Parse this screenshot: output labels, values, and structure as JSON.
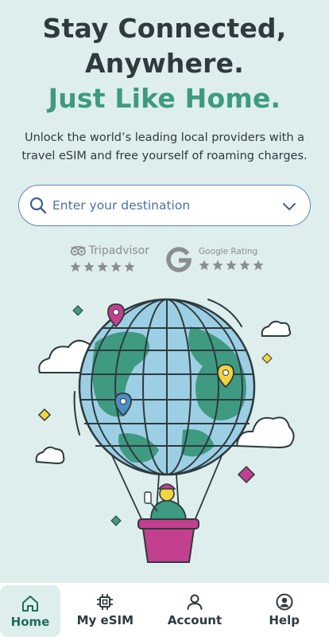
{
  "hero": {
    "line1": "Stay Connected,",
    "line2": "Anywhere.",
    "line3": "Just Like Home."
  },
  "subtitle": "Unlock the world’s leading local providers with a travel eSIM and free yourself of roaming charges.",
  "search": {
    "placeholder": "Enter your destination",
    "icon": "search-icon",
    "dropdown_icon": "chevron-down-icon"
  },
  "ratings": {
    "tripadvisor_label": "Tripadvisor",
    "tripadvisor_stars": 5,
    "google_label": "Google Rating",
    "google_stars": 5
  },
  "nav": {
    "items": [
      {
        "label": "Home",
        "icon": "home-icon",
        "active": true
      },
      {
        "label": "My eSIM",
        "icon": "sim-chip-icon",
        "active": false
      },
      {
        "label": "Account",
        "icon": "user-icon",
        "active": false
      },
      {
        "label": "Help",
        "icon": "help-icon",
        "active": false
      }
    ]
  },
  "colors": {
    "background": "#ddeeec",
    "accent": "#3e9a80",
    "heading": "#2f3a3e",
    "search_border": "#5d83c4",
    "balloon_basket": "#c2408e"
  }
}
